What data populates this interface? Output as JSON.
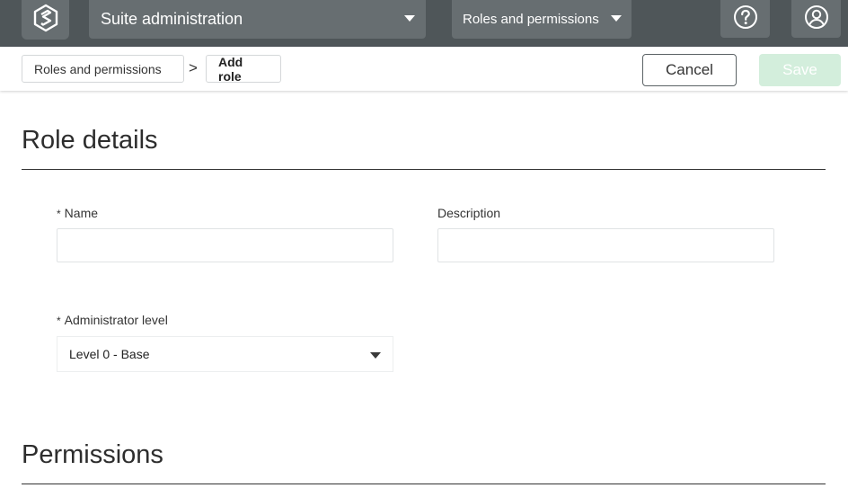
{
  "topbar": {
    "logo_icon": "suite-logo-icon",
    "app_selector": {
      "label": "Suite administration",
      "icon": "caret-down-icon"
    },
    "section_selector": {
      "label": "Roles and permissions",
      "icon": "caret-down-icon"
    },
    "help_icon": "help-circle-icon",
    "user_icon": "user-account-icon",
    "background": "#4f5659",
    "tab_color": "#676e71"
  },
  "breadcrumb": {
    "items": [
      {
        "label": "Roles and permissions"
      },
      {
        "label": "Add role"
      }
    ],
    "separator": ">"
  },
  "actions": {
    "cancel_label": "Cancel",
    "save_label": "Save",
    "save_color": "#d3eedc"
  },
  "role_details": {
    "title": "Role details",
    "name": {
      "label": "Name",
      "required_mark": "*",
      "value": "",
      "placeholder": ""
    },
    "description": {
      "label": "Description",
      "value": "",
      "placeholder": ""
    },
    "admin_level": {
      "label": "Administrator level",
      "required_mark": "*",
      "selected": "Level 0 - Base"
    }
  },
  "permissions": {
    "title": "Permissions"
  }
}
